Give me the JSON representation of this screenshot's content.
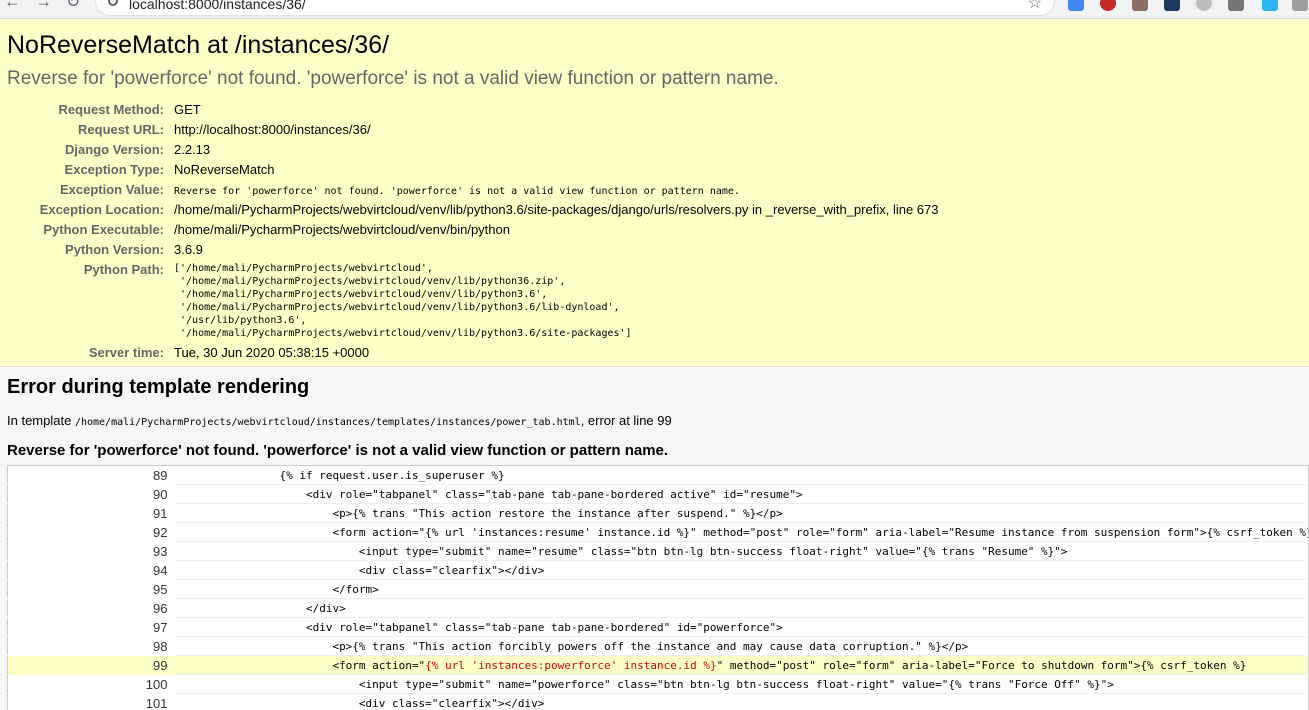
{
  "browser": {
    "url": "localhost:8000/instances/36/"
  },
  "summary": {
    "title": "NoReverseMatch at /instances/36/",
    "subtitle": "Reverse for 'powerforce' not found. 'powerforce' is not a valid view function or pattern name.",
    "rows": {
      "request_method": {
        "label": "Request Method:",
        "value": "GET"
      },
      "request_url": {
        "label": "Request URL:",
        "value": "http://localhost:8000/instances/36/"
      },
      "django_version": {
        "label": "Django Version:",
        "value": "2.2.13"
      },
      "exception_type": {
        "label": "Exception Type:",
        "value": "NoReverseMatch"
      },
      "exception_value": {
        "label": "Exception Value:",
        "value": "Reverse for 'powerforce' not found. 'powerforce' is not a valid view function or pattern name."
      },
      "exception_location": {
        "label": "Exception Location:",
        "value": "/home/mali/PycharmProjects/webvirtcloud/venv/lib/python3.6/site-packages/django/urls/resolvers.py in _reverse_with_prefix, line 673"
      },
      "python_executable": {
        "label": "Python Executable:",
        "value": "/home/mali/PycharmProjects/webvirtcloud/venv/bin/python"
      },
      "python_version": {
        "label": "Python Version:",
        "value": "3.6.9"
      },
      "python_path": {
        "label": "Python Path:",
        "value": "['/home/mali/PycharmProjects/webvirtcloud',\n '/home/mali/PycharmProjects/webvirtcloud/venv/lib/python36.zip',\n '/home/mali/PycharmProjects/webvirtcloud/venv/lib/python3.6',\n '/home/mali/PycharmProjects/webvirtcloud/venv/lib/python3.6/lib-dynload',\n '/usr/lib/python3.6',\n '/home/mali/PycharmProjects/webvirtcloud/venv/lib/python3.6/site-packages']"
      },
      "server_time": {
        "label": "Server time:",
        "value": "Tue, 30 Jun 2020 05:38:15 +0000"
      }
    }
  },
  "template": {
    "heading": "Error during template rendering",
    "in_template": "In template",
    "path": "/home/mali/PycharmProjects/webvirtcloud/instances/templates/instances/power_tab.html",
    "error_line_text": ", error at line 99",
    "message": "Reverse for 'powerforce' not found. 'powerforce' is not a valid view function or pattern name.",
    "lines": [
      {
        "num": "89",
        "code": "                {% if request.user.is_superuser %}"
      },
      {
        "num": "90",
        "code": "                    <div role=\"tabpanel\" class=\"tab-pane tab-pane-bordered active\" id=\"resume\">"
      },
      {
        "num": "91",
        "code": "                        <p>{% trans \"This action restore the instance after suspend.\" %}</p>"
      },
      {
        "num": "92",
        "code": "                        <form action=\"{% url 'instances:resume' instance.id %}\" method=\"post\" role=\"form\" aria-label=\"Resume instance from suspension form\">{% csrf_token %}"
      },
      {
        "num": "93",
        "code": "                            <input type=\"submit\" name=\"resume\" class=\"btn btn-lg btn-success float-right\" value=\"{% trans \"Resume\" %}\">"
      },
      {
        "num": "94",
        "code": "                            <div class=\"clearfix\"></div>"
      },
      {
        "num": "95",
        "code": "                        </form>"
      },
      {
        "num": "96",
        "code": "                    </div>"
      },
      {
        "num": "97",
        "code": "                    <div role=\"tabpanel\" class=\"tab-pane tab-pane-bordered\" id=\"powerforce\">"
      },
      {
        "num": "98",
        "code": "                        <p>{% trans \"This action forcibly powers off the instance and may cause data corruption.\" %}</p>"
      },
      {
        "num": "99",
        "pre": "                        <form action=\"",
        "err": "{% url 'instances:powerforce' instance.id %}",
        "post": "\" method=\"post\" role=\"form\" aria-label=\"Force to shutdown form\">{% csrf_token %}"
      },
      {
        "num": "100",
        "code": "                            <input type=\"submit\" name=\"powerforce\" class=\"btn btn-lg btn-success float-right\" value=\"{% trans \"Force Off\" %}\">"
      },
      {
        "num": "101",
        "code": "                            <div class=\"clearfix\"></div>"
      }
    ]
  },
  "colors": {
    "summary_bg": "#ffffc8",
    "template_bg": "#f6f6f6",
    "error_text": "#dd0000"
  }
}
